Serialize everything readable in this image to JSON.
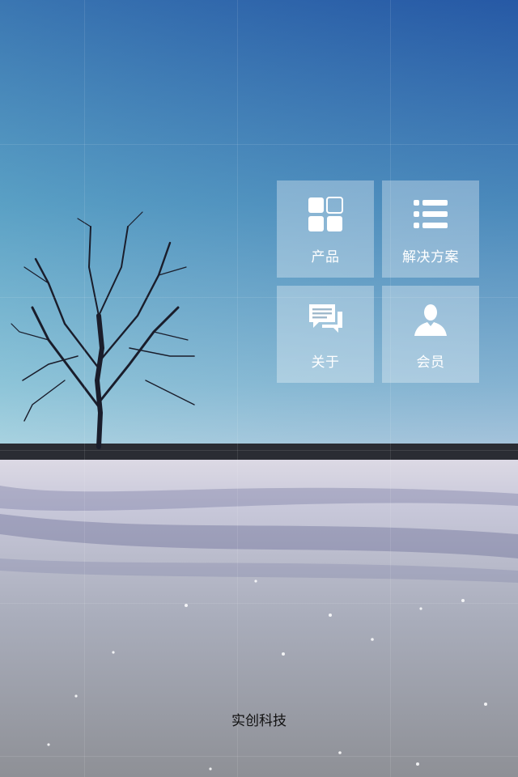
{
  "menu": {
    "tiles": [
      {
        "label": "产品",
        "icon": "grid-icon"
      },
      {
        "label": "解决方案",
        "icon": "list-icon"
      },
      {
        "label": "关于",
        "icon": "chat-icon"
      },
      {
        "label": "会员",
        "icon": "user-icon"
      }
    ]
  },
  "footer": {
    "company": "实创科技"
  },
  "colors": {
    "sky_top": "#2a5fa8",
    "sky_bottom": "#bfe3ec",
    "snow": "#cfd3da",
    "tile_bg": "rgba(255,255,255,0.32)"
  }
}
